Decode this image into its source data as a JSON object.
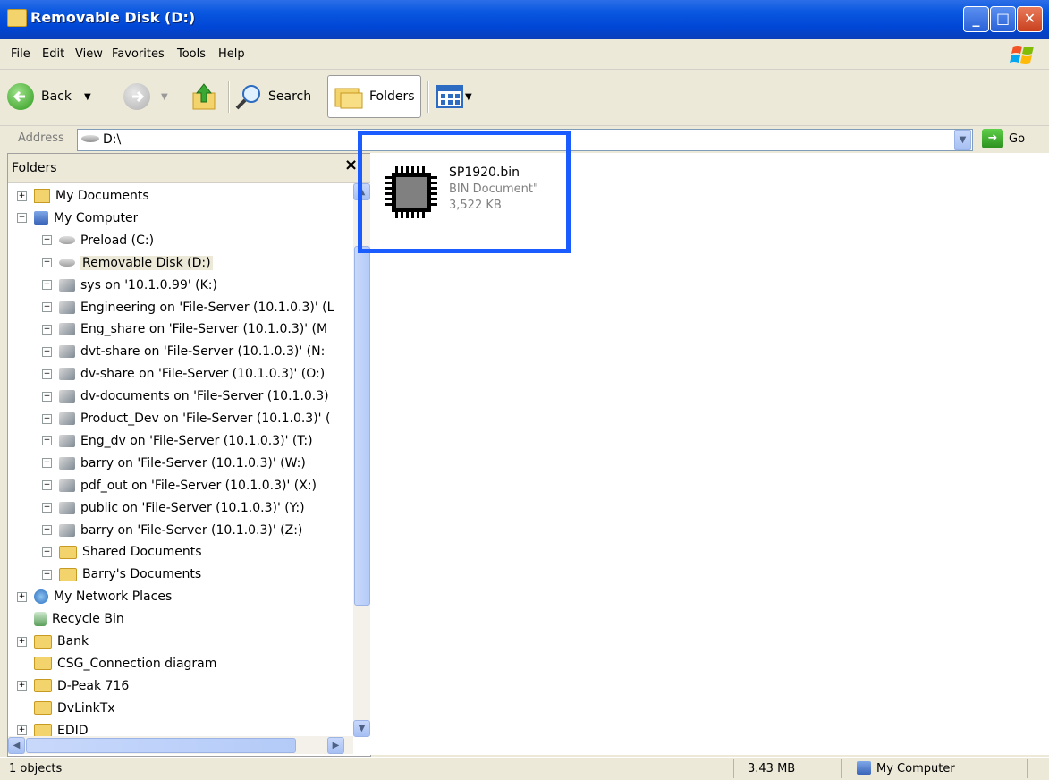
{
  "window": {
    "title": "Removable Disk (D:)"
  },
  "menu": [
    "File",
    "Edit",
    "View",
    "Favorites",
    "Tools",
    "Help"
  ],
  "toolbar": {
    "back_label": "Back",
    "search_label": "Search",
    "folders_label": "Folders"
  },
  "address": {
    "label": "Address",
    "value": "D:\\",
    "go_label": "Go"
  },
  "folders_pane": {
    "title": "Folders",
    "close_glyph": "×",
    "items": [
      {
        "label": "My Documents",
        "icon": "docs",
        "expander": "+"
      },
      {
        "label": "My Computer",
        "icon": "comp",
        "expander": "−"
      },
      {
        "label": "Preload (C:)",
        "icon": "drive",
        "expander": "+"
      },
      {
        "label": "Removable Disk (D:)",
        "icon": "drive",
        "expander": "+",
        "selected": true
      },
      {
        "label": "sys on '10.1.0.99' (K:)",
        "icon": "net",
        "expander": "+"
      },
      {
        "label": "Engineering on 'File-Server (10.1.0.3)' (L",
        "icon": "net",
        "expander": "+"
      },
      {
        "label": "Eng_share on 'File-Server (10.1.0.3)' (M",
        "icon": "net",
        "expander": "+"
      },
      {
        "label": "dvt-share on 'File-Server (10.1.0.3)' (N:",
        "icon": "net",
        "expander": "+"
      },
      {
        "label": "dv-share on 'File-Server (10.1.0.3)' (O:)",
        "icon": "net",
        "expander": "+"
      },
      {
        "label": "dv-documents on 'File-Server (10.1.0.3)",
        "icon": "net",
        "expander": "+"
      },
      {
        "label": "Product_Dev on 'File-Server (10.1.0.3)' (",
        "icon": "net",
        "expander": "+"
      },
      {
        "label": "Eng_dv on 'File-Server (10.1.0.3)' (T:)",
        "icon": "net",
        "expander": "+"
      },
      {
        "label": "barry on 'File-Server (10.1.0.3)' (W:)",
        "icon": "net",
        "expander": "+"
      },
      {
        "label": "pdf_out on 'File-Server (10.1.0.3)' (X:)",
        "icon": "net",
        "expander": "+"
      },
      {
        "label": "public on 'File-Server (10.1.0.3)' (Y:)",
        "icon": "net",
        "expander": "+"
      },
      {
        "label": "barry on 'File-Server (10.1.0.3)' (Z:)",
        "icon": "net",
        "expander": "+"
      },
      {
        "label": "Shared Documents",
        "icon": "folder",
        "expander": "+"
      },
      {
        "label": "Barry's Documents",
        "icon": "folder",
        "expander": "+"
      },
      {
        "label": "My Network Places",
        "icon": "netplaces",
        "expander": "+"
      },
      {
        "label": "Recycle Bin",
        "icon": "recycle",
        "expander": ""
      },
      {
        "label": "Bank",
        "icon": "folder",
        "expander": "+"
      },
      {
        "label": "CSG_Connection diagram",
        "icon": "folder",
        "expander": ""
      },
      {
        "label": "D-Peak 716",
        "icon": "folder",
        "expander": "+"
      },
      {
        "label": "DvLinkTx",
        "icon": "folder",
        "expander": ""
      },
      {
        "label": "EDID",
        "icon": "folder",
        "expander": "+"
      }
    ]
  },
  "file": {
    "name": "SP1920.bin",
    "type": "BIN Document\"",
    "size": "3,522 KB"
  },
  "status": {
    "objects": "1 objects",
    "size": "3.43 MB",
    "location": "My Computer"
  },
  "colors": {
    "highlight_box": "#1a5cff",
    "titlebar": "#0046d5"
  }
}
